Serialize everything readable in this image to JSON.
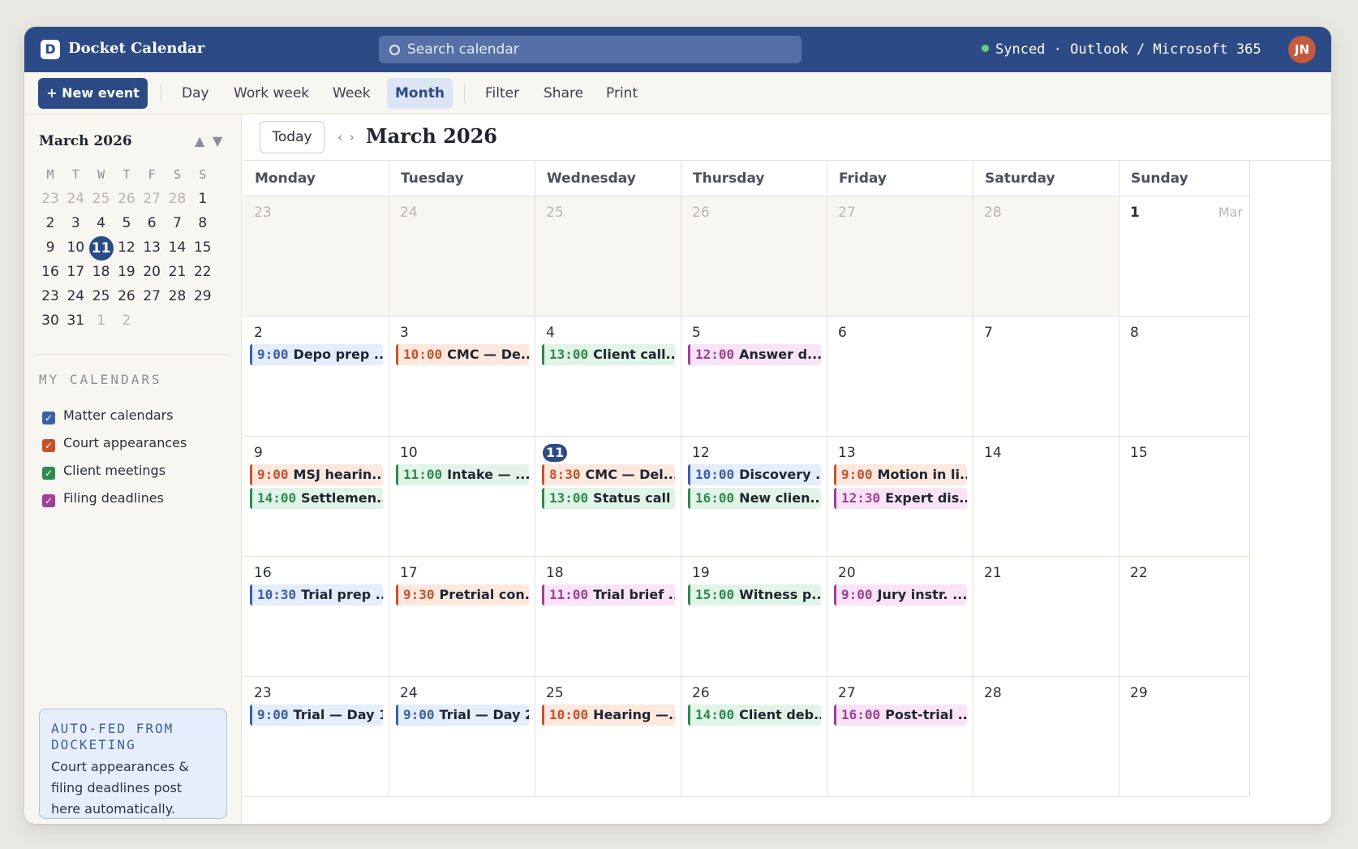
{
  "app": {
    "logo_letter": "D",
    "title": "Docket Calendar"
  },
  "search": {
    "placeholder": "Search calendar"
  },
  "sync": {
    "status": "Synced",
    "separator": "·",
    "provider": "Outlook / Microsoft 365"
  },
  "user": {
    "initials": "JN"
  },
  "toolbar": {
    "new_event_label": "+ New event",
    "views": [
      "Day",
      "Work week",
      "Week",
      "Month"
    ],
    "active_view": "Month",
    "actions": [
      "Filter",
      "Share",
      "Print"
    ]
  },
  "mini_calendar": {
    "title": "March 2026",
    "prev_glyph": "▲",
    "next_glyph": "▼",
    "weekday_heads": [
      "M",
      "T",
      "W",
      "T",
      "F",
      "S",
      "S"
    ],
    "weeks": [
      [
        {
          "d": "23",
          "m": true
        },
        {
          "d": "24",
          "m": true
        },
        {
          "d": "25",
          "m": true
        },
        {
          "d": "26",
          "m": true
        },
        {
          "d": "27",
          "m": true
        },
        {
          "d": "28",
          "m": true
        },
        {
          "d": "1"
        }
      ],
      [
        {
          "d": "2"
        },
        {
          "d": "3"
        },
        {
          "d": "4"
        },
        {
          "d": "5"
        },
        {
          "d": "6"
        },
        {
          "d": "7"
        },
        {
          "d": "8"
        }
      ],
      [
        {
          "d": "9"
        },
        {
          "d": "10"
        },
        {
          "d": "11",
          "today": true
        },
        {
          "d": "12"
        },
        {
          "d": "13"
        },
        {
          "d": "14"
        },
        {
          "d": "15"
        }
      ],
      [
        {
          "d": "16"
        },
        {
          "d": "17"
        },
        {
          "d": "18"
        },
        {
          "d": "19"
        },
        {
          "d": "20"
        },
        {
          "d": "21"
        },
        {
          "d": "22"
        }
      ],
      [
        {
          "d": "23"
        },
        {
          "d": "24"
        },
        {
          "d": "25"
        },
        {
          "d": "26"
        },
        {
          "d": "27"
        },
        {
          "d": "28"
        },
        {
          "d": "29"
        }
      ],
      [
        {
          "d": "30"
        },
        {
          "d": "31"
        },
        {
          "d": "1",
          "m": true
        },
        {
          "d": "2",
          "m": true
        }
      ]
    ]
  },
  "my_calendars": {
    "title": "MY CALENDARS",
    "items": [
      {
        "label": "Matter calendars",
        "color": "#3d5fa6",
        "checked": true
      },
      {
        "label": "Court appearances",
        "color": "#c7522a",
        "checked": true
      },
      {
        "label": "Client meetings",
        "color": "#2e8a4e",
        "checked": true
      },
      {
        "label": "Filing deadlines",
        "color": "#a03f95",
        "checked": true
      }
    ]
  },
  "note": {
    "title": "AUTO-FED FROM DOCKETING",
    "body": "Court appearances & filing deadlines post here automatically."
  },
  "main": {
    "today_label": "Today",
    "nav_glyphs": "‹ ›",
    "title": "March 2026"
  },
  "month": {
    "weekdays": [
      "Monday",
      "Tuesday",
      "Wednesday",
      "Thursday",
      "Friday",
      "Saturday",
      "Sunday"
    ],
    "weeks": [
      [
        {
          "day": "23",
          "outside": true,
          "events": []
        },
        {
          "day": "24",
          "outside": true,
          "events": []
        },
        {
          "day": "25",
          "outside": true,
          "events": []
        },
        {
          "day": "26",
          "outside": true,
          "events": []
        },
        {
          "day": "27",
          "outside": true,
          "events": []
        },
        {
          "day": "28",
          "outside": true,
          "events": []
        },
        {
          "day": "1",
          "bold": true,
          "month_label": "Mar",
          "events": []
        }
      ],
      [
        {
          "day": "2",
          "events": [
            {
              "time": "9:00",
              "title": "Depo prep ...",
              "cal": "matter"
            }
          ]
        },
        {
          "day": "3",
          "events": [
            {
              "time": "10:00",
              "title": "CMC — De...",
              "cal": "court"
            }
          ]
        },
        {
          "day": "4",
          "events": [
            {
              "time": "13:00",
              "title": "Client call...",
              "cal": "client"
            }
          ]
        },
        {
          "day": "5",
          "events": [
            {
              "time": "12:00",
              "title": "Answer d...",
              "cal": "filing"
            }
          ]
        },
        {
          "day": "6",
          "events": []
        },
        {
          "day": "7",
          "events": []
        },
        {
          "day": "8",
          "events": []
        }
      ],
      [
        {
          "day": "9",
          "events": [
            {
              "time": "9:00",
              "title": "MSJ hearin...",
              "cal": "court"
            },
            {
              "time": "14:00",
              "title": "Settlemen...",
              "cal": "client"
            }
          ]
        },
        {
          "day": "10",
          "events": [
            {
              "time": "11:00",
              "title": "Intake — ...",
              "cal": "client"
            }
          ]
        },
        {
          "day": "11",
          "today": true,
          "events": [
            {
              "time": "8:30",
              "title": "CMC — Del...",
              "cal": "court"
            },
            {
              "time": "13:00",
              "title": "Status call",
              "cal": "client"
            }
          ]
        },
        {
          "day": "12",
          "events": [
            {
              "time": "10:00",
              "title": "Discovery ...",
              "cal": "matter"
            },
            {
              "time": "16:00",
              "title": "New clien...",
              "cal": "client"
            }
          ]
        },
        {
          "day": "13",
          "events": [
            {
              "time": "9:00",
              "title": "Motion in li...",
              "cal": "court"
            },
            {
              "time": "12:30",
              "title": "Expert dis...",
              "cal": "filing"
            }
          ]
        },
        {
          "day": "14",
          "events": []
        },
        {
          "day": "15",
          "events": []
        }
      ],
      [
        {
          "day": "16",
          "events": [
            {
              "time": "10:30",
              "title": "Trial prep ...",
              "cal": "matter"
            }
          ]
        },
        {
          "day": "17",
          "events": [
            {
              "time": "9:30",
              "title": "Pretrial con...",
              "cal": "court"
            }
          ]
        },
        {
          "day": "18",
          "events": [
            {
              "time": "11:00",
              "title": "Trial brief ...",
              "cal": "filing"
            }
          ]
        },
        {
          "day": "19",
          "events": [
            {
              "time": "15:00",
              "title": "Witness p...",
              "cal": "client"
            }
          ]
        },
        {
          "day": "20",
          "events": [
            {
              "time": "9:00",
              "title": "Jury instr. ...",
              "cal": "filing"
            }
          ]
        },
        {
          "day": "21",
          "events": []
        },
        {
          "day": "22",
          "events": []
        }
      ],
      [
        {
          "day": "23",
          "events": [
            {
              "time": "9:00",
              "title": "Trial — Day 1",
              "cal": "matter"
            }
          ]
        },
        {
          "day": "24",
          "events": [
            {
              "time": "9:00",
              "title": "Trial — Day 2",
              "cal": "matter"
            }
          ]
        },
        {
          "day": "25",
          "events": [
            {
              "time": "10:00",
              "title": "Hearing —...",
              "cal": "court"
            }
          ]
        },
        {
          "day": "26",
          "events": [
            {
              "time": "14:00",
              "title": "Client deb...",
              "cal": "client"
            }
          ]
        },
        {
          "day": "27",
          "events": [
            {
              "time": "16:00",
              "title": "Post-trial ...",
              "cal": "filing"
            }
          ]
        },
        {
          "day": "28",
          "events": []
        },
        {
          "day": "29",
          "events": []
        }
      ]
    ]
  }
}
